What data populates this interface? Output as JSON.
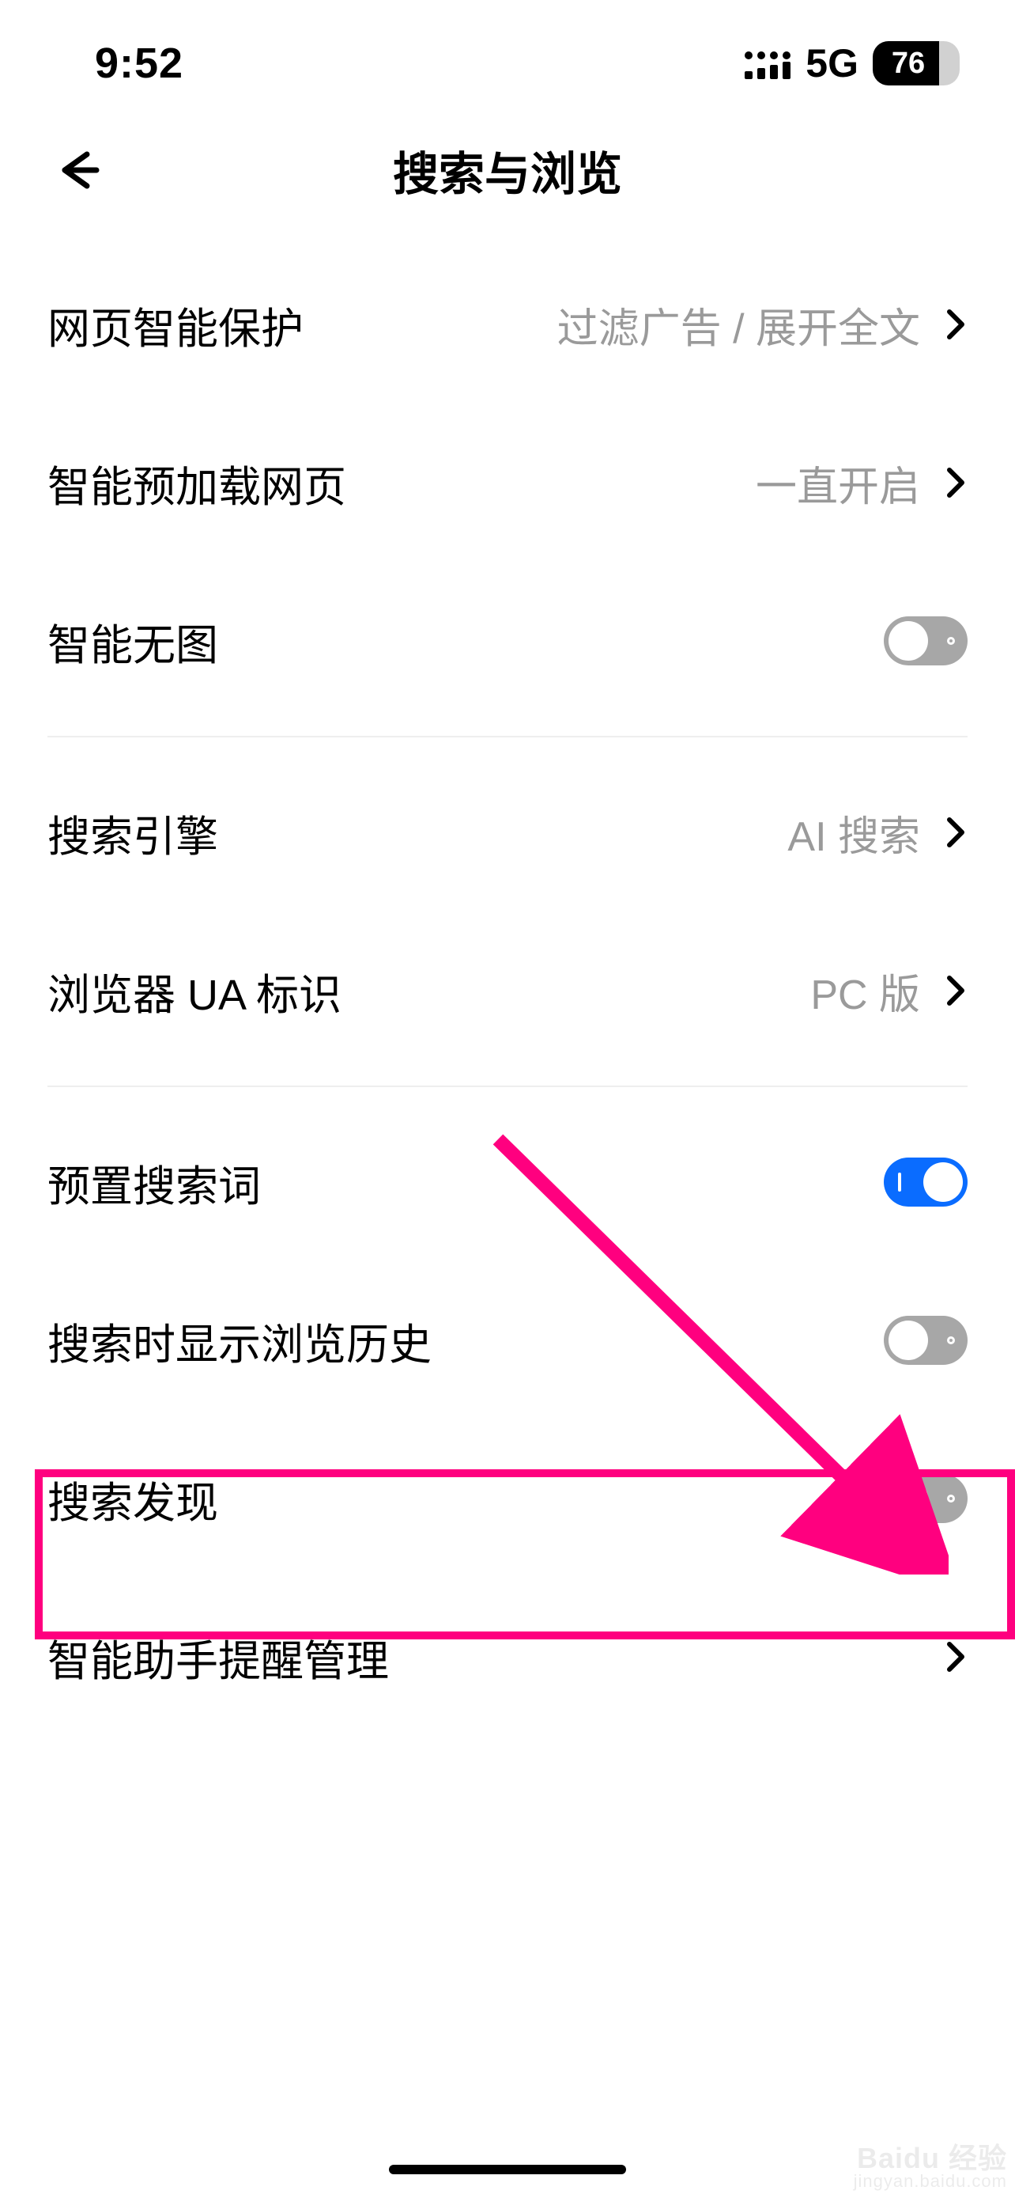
{
  "status": {
    "time": "9:52",
    "network": "5G",
    "battery": "76"
  },
  "header": {
    "title": "搜索与浏览"
  },
  "section1": {
    "row0": {
      "label": "网页智能保护",
      "value": "过滤广告 / 展开全文"
    },
    "row1": {
      "label": "智能预加载网页",
      "value": "一直开启"
    },
    "row2": {
      "label": "智能无图"
    }
  },
  "section2": {
    "row0": {
      "label": "搜索引擎",
      "value": "AI 搜索"
    },
    "row1": {
      "label": "浏览器 UA 标识",
      "value": "PC 版"
    }
  },
  "section3": {
    "row0": {
      "label": "预置搜索词"
    },
    "row1": {
      "label": "搜索时显示浏览历史"
    },
    "row2": {
      "label": "搜索发现"
    },
    "row3": {
      "label": "智能助手提醒管理"
    }
  },
  "watermark": {
    "main": "Baidu 经验",
    "sub": "jingyan.baidu.com"
  }
}
